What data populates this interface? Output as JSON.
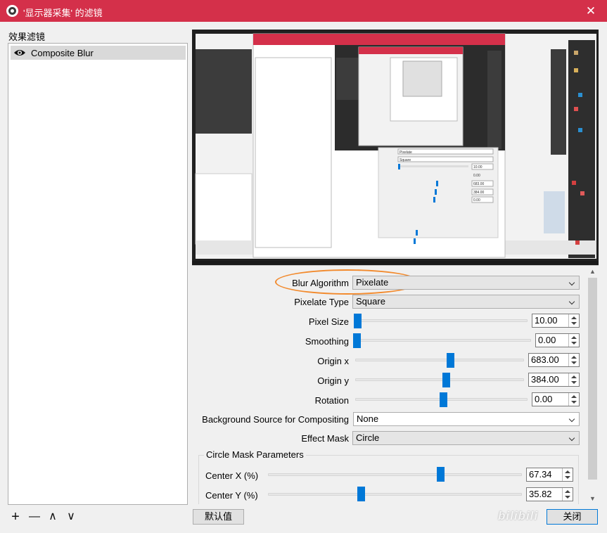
{
  "window": {
    "title": "'显示器采集' 的滤镜",
    "close_label": "✕"
  },
  "filters": {
    "label": "效果滤镜",
    "items": [
      {
        "name": "Composite Blur",
        "visible": true
      }
    ],
    "tools": {
      "add": "+",
      "remove": "—",
      "up": "∧",
      "down": "∨"
    }
  },
  "preview": {
    "inner_values": [
      "Pixelate",
      "Square",
      "10.00",
      "0.00",
      "683.00",
      "384.00",
      "0.00"
    ]
  },
  "properties": {
    "blur_algorithm": {
      "label": "Blur Algorithm",
      "value": "Pixelate"
    },
    "pixelate_type": {
      "label": "Pixelate Type",
      "value": "Square"
    },
    "pixel_size": {
      "label": "Pixel Size",
      "value": "10.00",
      "level": 0.0
    },
    "smoothing": {
      "label": "Smoothing",
      "value": "0.00",
      "level": 0.0
    },
    "origin_x": {
      "label": "Origin x",
      "value": "683.00",
      "level": 0.5
    },
    "origin_y": {
      "label": "Origin y",
      "value": "384.00",
      "level": 0.5
    },
    "rotation": {
      "label": "Rotation",
      "value": "0.00",
      "level": 0.5
    },
    "background_source": {
      "label": "Background Source for Compositing",
      "value": "None"
    },
    "effect_mask": {
      "label": "Effect Mask",
      "value": "Circle"
    },
    "circle_mask": {
      "title": "Circle Mask Parameters",
      "center_x": {
        "label": "Center X (%)",
        "value": "67.34",
        "level": 0.6734
      },
      "center_y": {
        "label": "Center Y (%)",
        "value": "35.82",
        "level": 0.3582
      }
    }
  },
  "buttons": {
    "defaults": "默认值",
    "close": "关闭"
  },
  "watermark": "bilibili",
  "colors": {
    "titlebar": "#d4304a",
    "accent": "#0078d7",
    "highlight": "#f28a2d"
  }
}
